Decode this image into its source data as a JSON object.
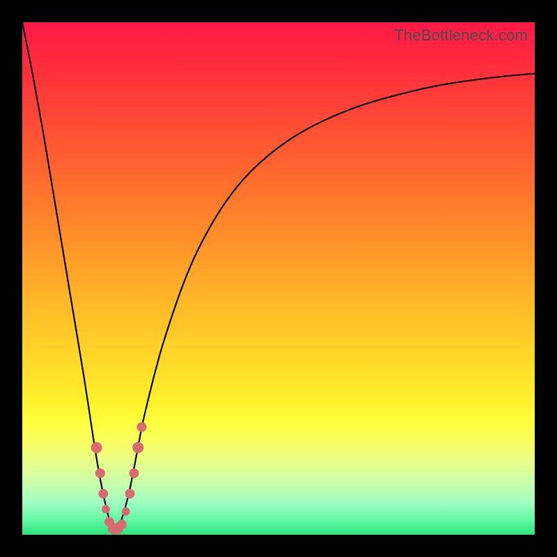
{
  "watermark": "TheBottleneck.com",
  "colors": {
    "frame": "#000000",
    "curve": "#000000",
    "marker": "#d86b6f",
    "gradient_top": "#ff1a47",
    "gradient_bottom": "#2be57c"
  },
  "chart_data": {
    "type": "line",
    "title": "",
    "xlabel": "",
    "ylabel": "",
    "xlim": [
      0,
      100
    ],
    "ylim": [
      0,
      100
    ],
    "note": "No axes or tick labels are rendered; values are read off pixel positions relative to the 736×736 plot area. x≈18 is the curve minimum (~0 bottleneck).",
    "series": [
      {
        "name": "bottleneck-curve",
        "x": [
          0,
          2,
          4,
          6,
          8,
          10,
          12,
          14,
          15,
          16,
          17,
          18,
          19,
          20,
          21,
          22,
          24,
          28,
          34,
          42,
          52,
          64,
          78,
          90,
          100
        ],
        "y": [
          100,
          90,
          79,
          67,
          55,
          43,
          31,
          18,
          12,
          7,
          3,
          1,
          2,
          5,
          9,
          14,
          24,
          39,
          55,
          68,
          77,
          83,
          87,
          89,
          90
        ]
      }
    ],
    "markers": {
      "name": "highlighted-points",
      "points": [
        {
          "x": 14.5,
          "y": 17,
          "r": 8
        },
        {
          "x": 15.2,
          "y": 12,
          "r": 7
        },
        {
          "x": 15.8,
          "y": 8,
          "r": 7
        },
        {
          "x": 16.3,
          "y": 5,
          "r": 6
        },
        {
          "x": 17.0,
          "y": 2.5,
          "r": 7
        },
        {
          "x": 17.8,
          "y": 1.2,
          "r": 8
        },
        {
          "x": 18.6,
          "y": 1.2,
          "r": 8
        },
        {
          "x": 19.4,
          "y": 2.0,
          "r": 7
        },
        {
          "x": 20.2,
          "y": 4.5,
          "r": 6
        },
        {
          "x": 21.0,
          "y": 8,
          "r": 7
        },
        {
          "x": 21.8,
          "y": 12,
          "r": 7
        },
        {
          "x": 22.6,
          "y": 17,
          "r": 8
        },
        {
          "x": 23.3,
          "y": 21,
          "r": 7
        }
      ]
    }
  }
}
